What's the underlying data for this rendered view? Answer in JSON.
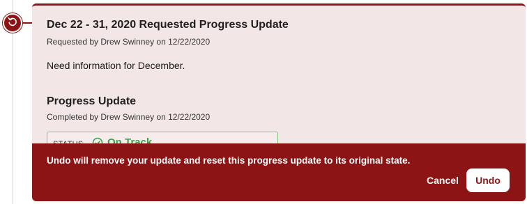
{
  "timeline": {
    "node_icon": "undo-icon",
    "accent_color": "#8d1414"
  },
  "request": {
    "title": "Dec 22 - 31, 2020 Requested Progress Update",
    "requested_by": "Requested by Drew Swinney on 12/22/2020",
    "note": "Need information for December."
  },
  "progress_update": {
    "title": "Progress Update",
    "completed_by": "Completed by Drew Swinney on 12/22/2020",
    "status_label": "STATUS",
    "status_value": "On Track",
    "status_icon": "check-circle-icon",
    "status_color": "#3aa34a"
  },
  "confirm": {
    "message": "Undo will remove your update and reset this progress update to its original state.",
    "cancel_label": "Cancel",
    "undo_label": "Undo"
  }
}
